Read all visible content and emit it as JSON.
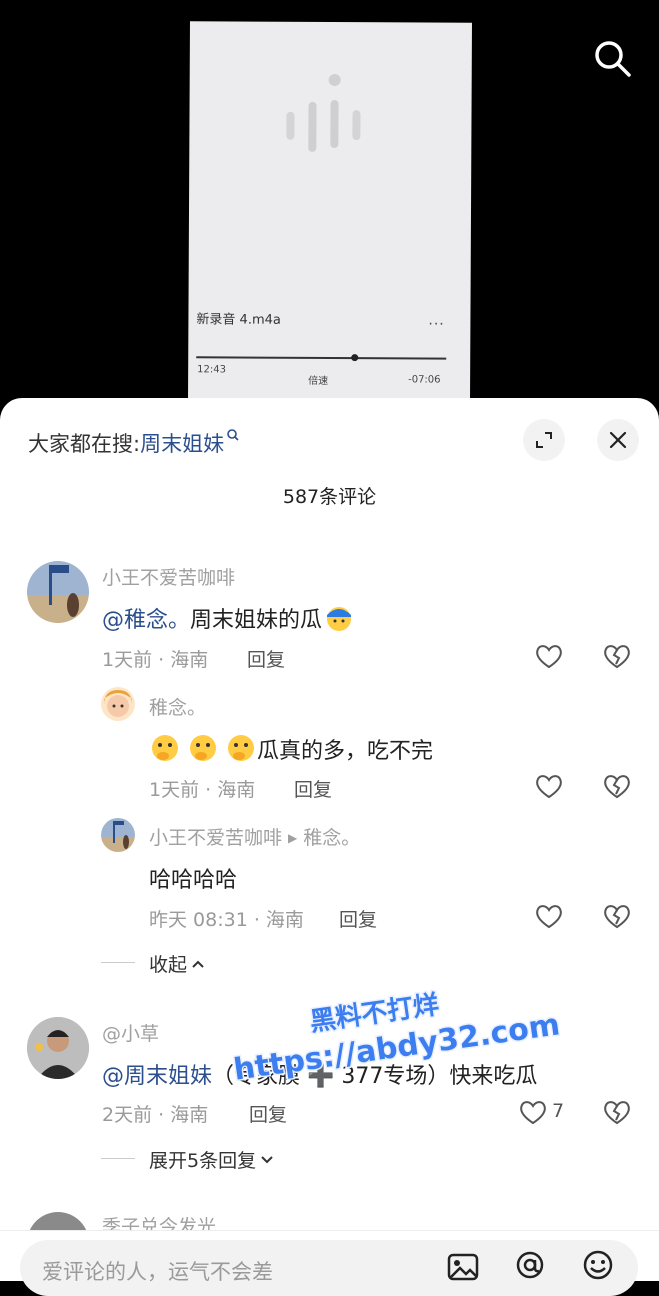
{
  "video": {
    "recording_name": "新录音  4.m4a",
    "more": "...",
    "time_elapsed": "12:43",
    "speed_label": "倍速",
    "time_remaining": "-07:06",
    "progress": 0.63
  },
  "header": {
    "hot_prefix": "大家都在搜:",
    "hot_keyword": "周末姐妹",
    "comment_count": "587条评论"
  },
  "comments": [
    {
      "user": "小王不爱苦咖啡",
      "mention": "@稚念。",
      "text": "周末姐妹的瓜",
      "meta": "1天前 · 海南",
      "reply": "回复"
    },
    {
      "user": "稚念。",
      "text": "瓜真的多，吃不完",
      "meta": "1天前 · 海南",
      "reply": "回复"
    },
    {
      "user": "小王不爱苦咖啡",
      "reply_to": "稚念。",
      "text": "哈哈哈哈",
      "meta": "昨天 08:31 · 海南",
      "reply": "回复"
    },
    {
      "user": "@小草",
      "mention": "@周末姐妹",
      "text": "（专家膜 ➕ 377专场）快来吃瓜",
      "meta": "2天前 · 海南",
      "reply": "回复",
      "likes": "7"
    },
    {
      "user": "季子兑今发光"
    }
  ],
  "collapse_label": "收起",
  "expand_label": "展开5条回复",
  "watermark": {
    "line1": "黑料不打烊",
    "line2": "https://abdy32.com"
  },
  "input": {
    "placeholder": "爱评论的人，运气不会差"
  }
}
